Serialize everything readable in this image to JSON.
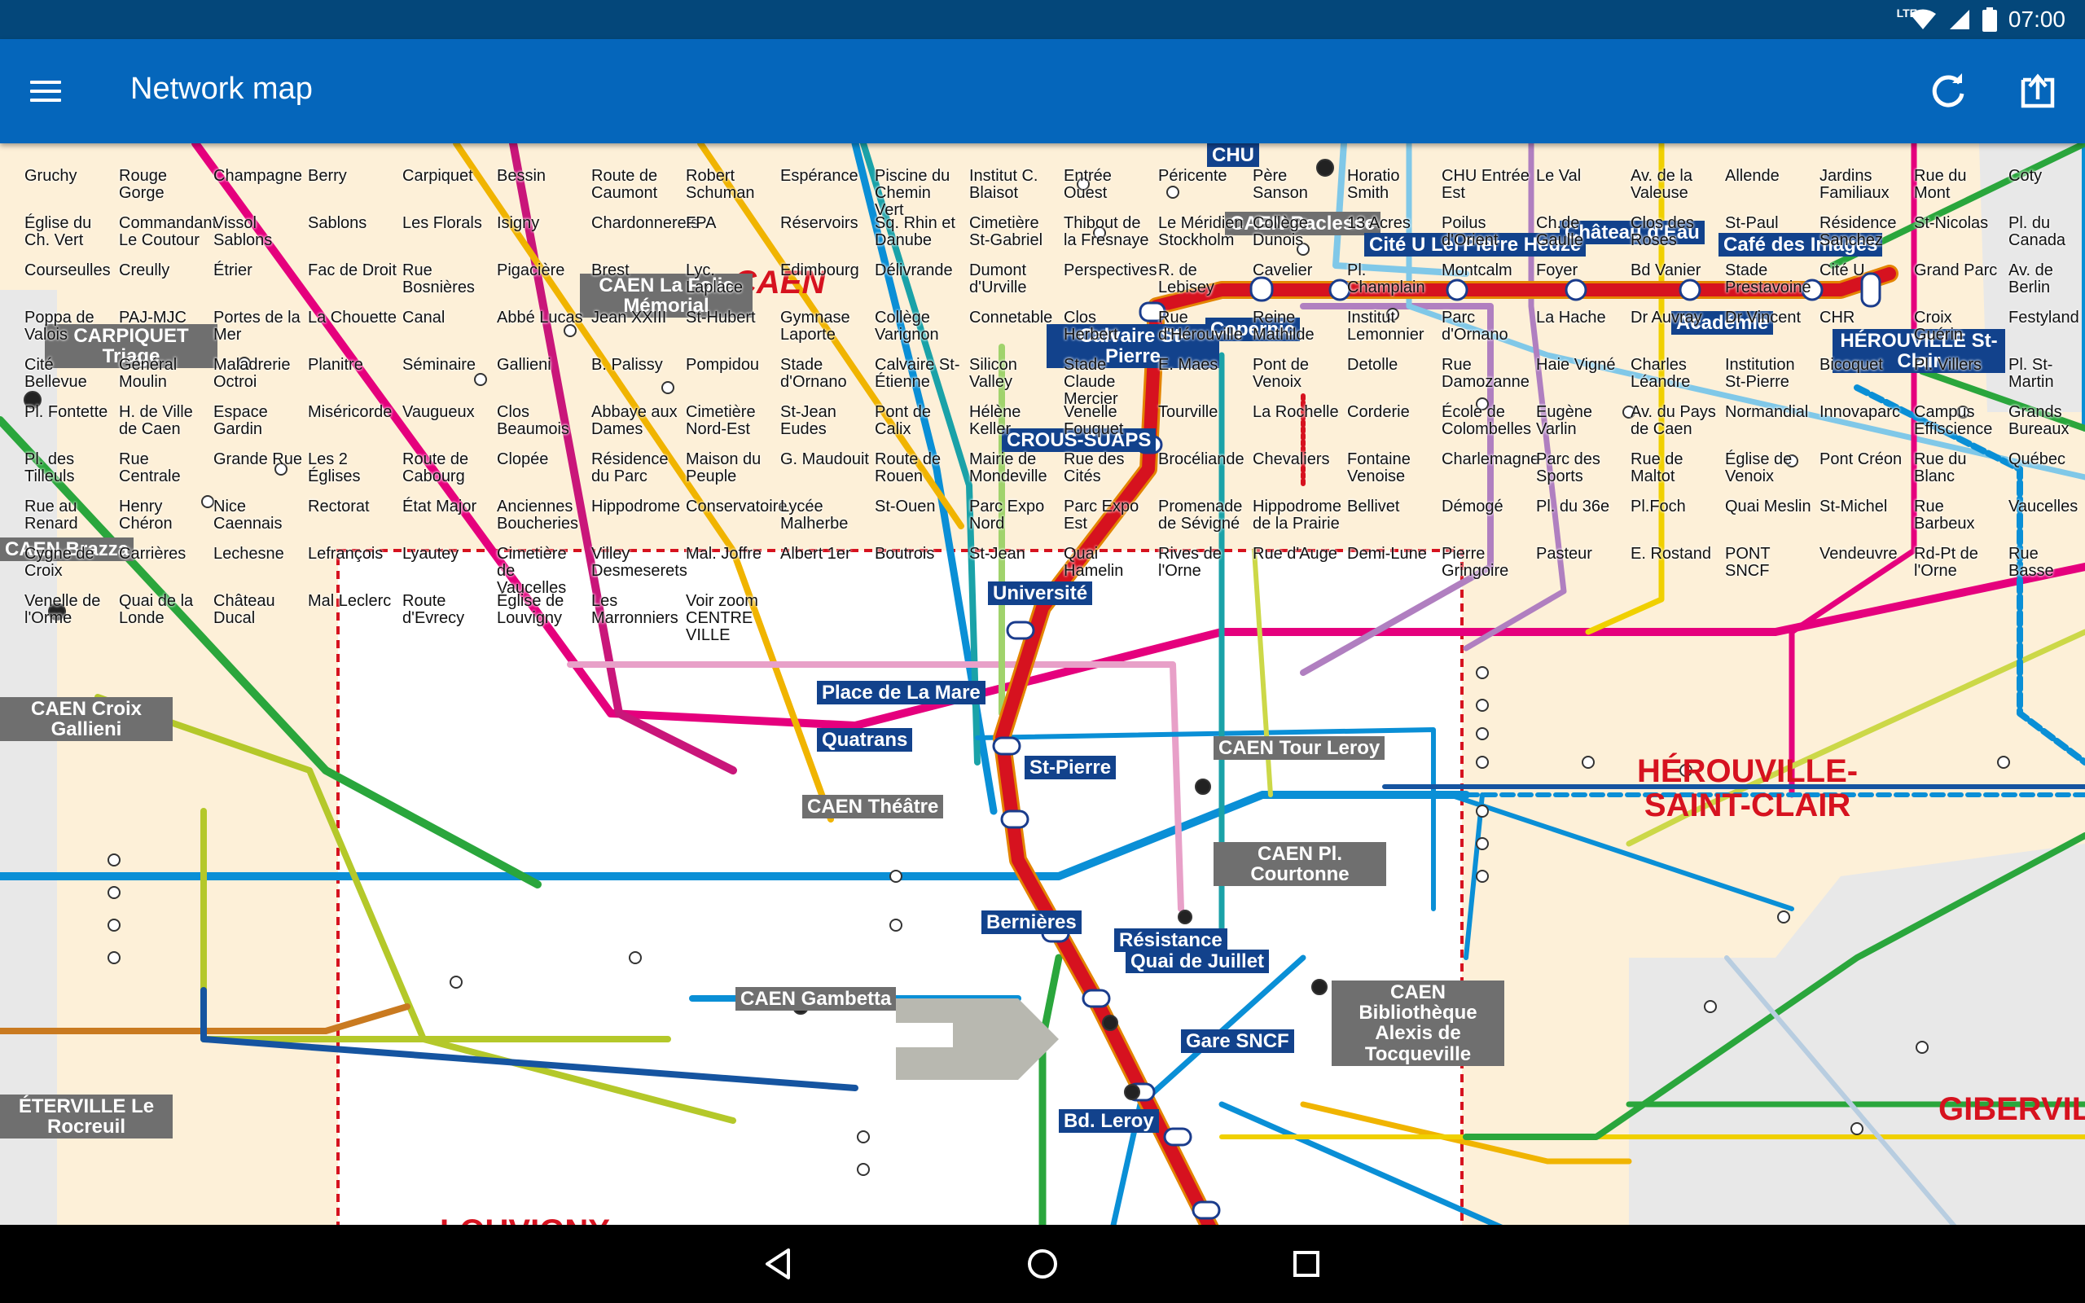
{
  "status_bar": {
    "time": "07:00",
    "network": "LTE",
    "icons": [
      "wifi-icon",
      "signal-icon",
      "battery-icon"
    ]
  },
  "app_bar": {
    "title": "Network map",
    "menu_icon": "menu-icon",
    "refresh_icon": "refresh-icon",
    "share_icon": "open-external-icon"
  },
  "nav_bar": {
    "icons": [
      "back-icon",
      "home-icon",
      "recents-icon"
    ]
  },
  "colors": {
    "status_bar": "#04477a",
    "app_bar": "#0566bb",
    "map_land": "#fdf0d8",
    "map_outside": "#e6e6e6",
    "tram_red": "#d6121f",
    "navy_label": "#12428c",
    "grey_label": "#6f6f6f"
  },
  "map": {
    "city_labels": [
      "CAEN",
      "HÉROUVILLE-\nSAINT-CLAIR",
      "GIBERVILLE",
      "LOUVIGNY"
    ],
    "hubs": [
      "CAEN La Folie Mémorial",
      "CHU",
      "CAEN Baclesse",
      "Cité U Lebisey",
      "Pierre Heuzé",
      "Château d'Eau",
      "Café des Images",
      "Calvaire St-Pierre",
      "Copernic",
      "Académie",
      "HÉROUVILLE St-Clair",
      "CROUS-SUAPS",
      "Université",
      "Place de La Mare",
      "Quatrans",
      "St-Pierre",
      "CAEN Tour Leroy",
      "CAEN Théâtre",
      "CAEN Pl. Courtonne",
      "Bernières",
      "Résistance",
      "Quai de Juillet",
      "CAEN Gambetta",
      "Gare SNCF",
      "Bd. Leroy",
      "CAEN Bibliothèque Alexis de Tocqueville",
      "CARPIQUET Triage",
      "CAEN Brazza",
      "CAEN Croix Gallieni",
      "ÉTERVILLE Le Rocreuil"
    ],
    "stops": [
      "Gruchy",
      "Rouge Gorge",
      "Champagne",
      "Berry",
      "Carpiquet",
      "Bessin",
      "Route de Caumont",
      "Robert Schuman",
      "Espérance",
      "Piscine du Chemin Vert",
      "Institut C. Blaisot",
      "Entrée Ouest",
      "Péricente",
      "Père Sanson",
      "Horatio Smith",
      "CHU Entrée Est",
      "Le Val",
      "Av. de la Valeuse",
      "Allende",
      "Jardins Familiaux",
      "Rue du Mont",
      "Coty",
      "Église du Ch. Vert",
      "Commandant Le Coutour",
      "Vissol Sablons",
      "Sablons",
      "Les Florals",
      "Isigny",
      "Chardonnerets",
      "FPA",
      "Réservoirs",
      "Sq. Rhin et Danube",
      "Cimetière St-Gabriel",
      "Thibout de la Fresnaye",
      "Le Méridien Stockholm",
      "Collège Dunois",
      "13 Acres",
      "Poilus d'Orient",
      "Ch.de Gaulle",
      "Clos des Roses",
      "St-Paul",
      "Résidence Sanchez",
      "St-Nicolas",
      "Pl. du Canada",
      "Courseulles",
      "Creully",
      "Étrier",
      "Fac de Droit",
      "Rue Bosnières",
      "Pigacière",
      "Brest",
      "Lyc. Laplace",
      "Edimbourg",
      "Délivrande",
      "Dumont d'Urville",
      "Perspectives",
      "R. de Lebisey",
      "Cavelier",
      "Pl. Champlain",
      "Montcalm",
      "Foyer",
      "Bd Vanier",
      "Stade Prestavoine",
      "Cité U",
      "Grand Parc",
      "Av. de Berlin",
      "Poppa de Valois",
      "PAJ-MJC",
      "Portes de la Mer",
      "La Chouette",
      "Canal",
      "Abbé Lucas",
      "Jean XXIII",
      "St-Hubert",
      "Gymnase Laporte",
      "Collège Varignon",
      "Connetable",
      "Clos Herbert",
      "Rue d'Hérouville",
      "Reine Mathilde",
      "Institut Lemonnier",
      "Parc d'Ornano",
      "La Hache",
      "Dr Auvray",
      "Dr Vincent",
      "CHR",
      "Croix Guérin",
      "Festyland",
      "Cité Bellevue",
      "Général Moulin",
      "Maladrerie Octroi",
      "Planitre",
      "Séminaire",
      "Gallieni",
      "B. Palissy",
      "Pompidou",
      "Stade d'Ornano",
      "Calvaire St-Étienne",
      "Silicon Valley",
      "Stade Claude Mercier",
      "E. Maes",
      "Pont de Venoix",
      "Detolle",
      "Rue Damozanne",
      "Haie Vigné",
      "Charles Léandre",
      "Institution St-Pierre",
      "Bicoquet",
      "Pl. Villers",
      "Pl. St-Martin",
      "Pl. Fontette",
      "H. de Ville de Caen",
      "Espace Gardin",
      "Miséricorde",
      "Vaugueux",
      "Clos Beaumois",
      "Abbaye aux Dames",
      "Cimetière Nord-Est",
      "St-Jean Eudes",
      "Pont de Calix",
      "Hélène Keller",
      "Venelle Fouquet",
      "Tourville",
      "La Rochelle",
      "Corderie",
      "École de Colombelles",
      "Eugène Varlin",
      "Av. du Pays de Caen",
      "Normandial",
      "Innovaparc",
      "Campus Effiscience",
      "Grands Bureaux",
      "Pl. des Tilleuls",
      "Rue Centrale",
      "Grande Rue",
      "Les 2 Églises",
      "Route de Cabourg",
      "Clopée",
      "Résidence du Parc",
      "Maison du Peuple",
      "G. Maudouit",
      "Route de Rouen",
      "Mairie de Mondeville",
      "Rue des Cités",
      "Brocéliande",
      "Chevaliers",
      "Fontaine Venoise",
      "Charlemagne",
      "Parc des Sports",
      "Rue de Maltot",
      "Église de Venoix",
      "Pont Créon",
      "Rue du Blanc",
      "Québec",
      "Rue au Renard",
      "Henry Chéron",
      "Nice Caennais",
      "Rectorat",
      "État Major",
      "Anciennes Boucheries",
      "Hippodrome",
      "Conservatoire",
      "Lycée Malherbe",
      "St-Ouen",
      "Parc Expo Nord",
      "Parc Expo Est",
      "Promenade de Sévigné",
      "Hippodrome de la Prairie",
      "Bellivet",
      "Démogé",
      "Pl. du 36e",
      "Pl.Foch",
      "Quai Meslin",
      "St-Michel",
      "Rue Barbeux",
      "Vaucelles",
      "Cygne de Croix",
      "Carrières",
      "Lechesne",
      "Lefrançois",
      "Lyautey",
      "Cimetière de Vaucelles",
      "Villey Desmeserets",
      "Mal. Joffre",
      "Albert 1er",
      "Boutrois",
      "St-Jean",
      "Quai Hamelin",
      "Rives de l'Orne",
      "Rue d'Auge",
      "Demi-Lune",
      "Pierre Gringoire",
      "Pasteur",
      "E. Rostand",
      "PONT SNCF",
      "Vendeuvre",
      "Rd-Pt de l'Orne",
      "Rue Basse",
      "Venelle de l'Orme",
      "Quai de la Londe",
      "Château Ducal",
      "Mal Leclerc",
      "Route d'Evrecy",
      "Église de Louvigny",
      "Les Marronniers",
      "Voir zoom CENTRE VILLE"
    ]
  }
}
